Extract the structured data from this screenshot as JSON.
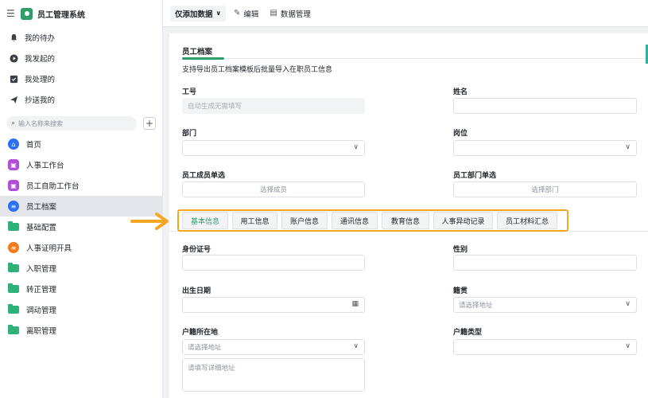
{
  "app": {
    "title": "员工管理系统"
  },
  "sidebar": {
    "quick": [
      {
        "label": "我的待办",
        "icon": "bell-icon"
      },
      {
        "label": "我发起的",
        "icon": "play-icon"
      },
      {
        "label": "我处理的",
        "icon": "check-box-icon"
      },
      {
        "label": "抄送我的",
        "icon": "send-icon"
      }
    ],
    "search_placeholder": "输入名称来搜索",
    "menu": [
      {
        "label": "首页",
        "icon": "home-icon",
        "color": "#2b6ff2"
      },
      {
        "label": "人事工作台",
        "icon": "dashboard-icon",
        "color": "#b04fd6"
      },
      {
        "label": "员工自助工作台",
        "icon": "dashboard-icon",
        "color": "#b04fd6"
      },
      {
        "label": "员工档案",
        "icon": "document-icon",
        "color": "#2b6ff2",
        "active": true
      },
      {
        "label": "基础配置",
        "icon": "folder-icon"
      },
      {
        "label": "人事证明开具",
        "icon": "certificate-icon",
        "color": "#f27a1a"
      },
      {
        "label": "入职管理",
        "icon": "folder-icon"
      },
      {
        "label": "转正管理",
        "icon": "folder-icon"
      },
      {
        "label": "调动管理",
        "icon": "folder-icon"
      },
      {
        "label": "离职管理",
        "icon": "folder-icon"
      }
    ]
  },
  "toolbar": {
    "view_label": "仅添加数据",
    "edit_label": "编辑",
    "data_manage_label": "数据管理"
  },
  "form": {
    "section_title": "员工档案",
    "description": "支持导出员工档案模板后批量导入在职员工信息",
    "employee_id_label": "工号",
    "employee_id_placeholder": "自动生成无需填写",
    "name_label": "姓名",
    "department_label": "部门",
    "position_label": "岗位",
    "member_single_label": "员工成员单选",
    "member_single_placeholder": "选择成员",
    "dept_single_label": "员工部门单选",
    "dept_single_placeholder": "选择部门",
    "tabs": [
      "基本信息",
      "用工信息",
      "账户信息",
      "通讯信息",
      "教育信息",
      "人事异动记录",
      "员工材料汇总"
    ],
    "id_card_label": "身份证号",
    "gender_label": "性别",
    "birth_label": "出生日期",
    "native_place_label": "籍贯",
    "native_place_placeholder": "请选择地址",
    "household_label": "户籍所在地",
    "household_placeholder": "请选择地址",
    "household_detail_placeholder": "请填写详细地址",
    "household_type_label": "户籍类型"
  },
  "colors": {
    "accent": "#2f9e6b",
    "highlight": "#f5a623"
  }
}
